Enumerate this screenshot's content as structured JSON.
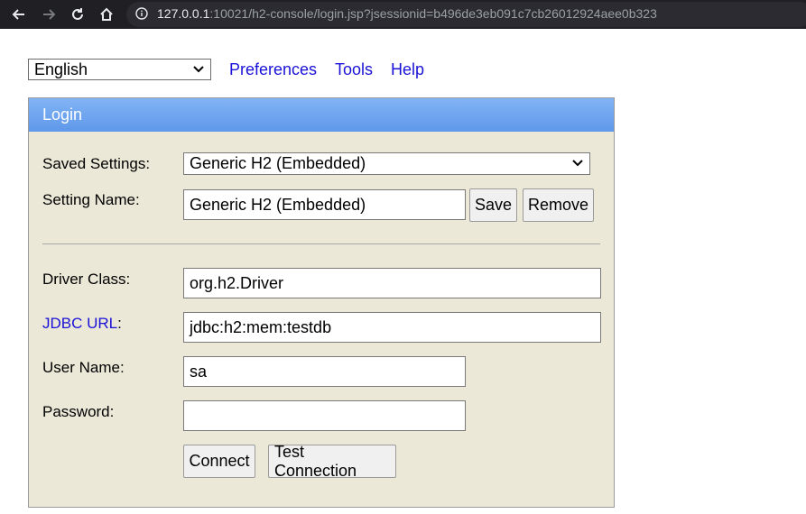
{
  "browser": {
    "url_host": "127.0.0.1",
    "url_rest": ":10021/h2-console/login.jsp?jsessionid=b496de3eb091c7cb26012924aee0b323"
  },
  "toolbar": {
    "language": "English",
    "preferences": "Preferences",
    "tools": "Tools",
    "help": "Help"
  },
  "login": {
    "title": "Login",
    "saved_settings_label": "Saved Settings:",
    "saved_settings_value": "Generic H2 (Embedded)",
    "setting_name_label": "Setting Name:",
    "setting_name_value": "Generic H2 (Embedded)",
    "save": "Save",
    "remove": "Remove",
    "driver_class_label": "Driver Class:",
    "driver_class_value": "org.h2.Driver",
    "jdbc_url_label": "JDBC URL",
    "jdbc_url_colon": ":",
    "jdbc_url_value": "jdbc:h2:mem:testdb",
    "user_name_label": "User Name:",
    "user_name_value": "sa",
    "password_label": "Password:",
    "password_value": "",
    "connect": "Connect",
    "test_connection": "Test Connection"
  }
}
